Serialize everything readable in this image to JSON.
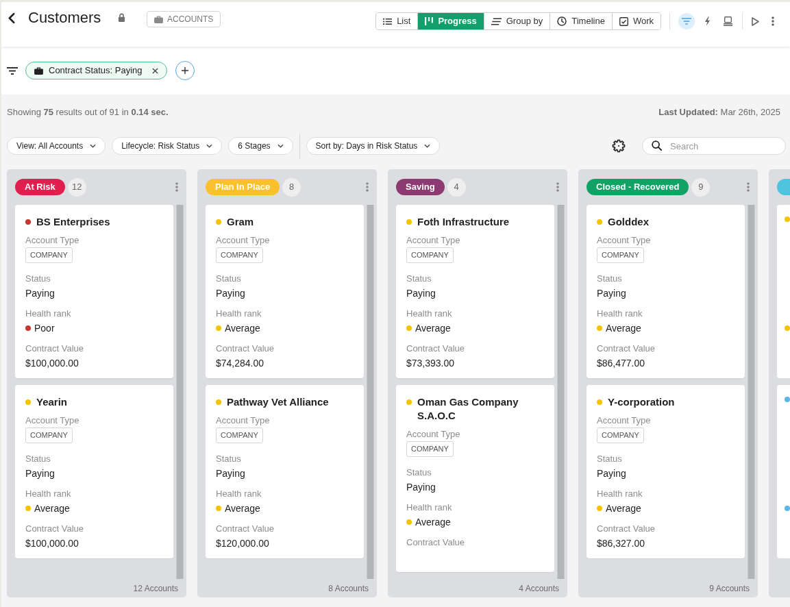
{
  "header": {
    "title": "Customers",
    "locked": true,
    "object_button": "ACCOUNTS"
  },
  "view_tabs": [
    {
      "label": "List",
      "kind": "list",
      "selected": false
    },
    {
      "label": "Progress",
      "kind": "progress",
      "selected": true
    },
    {
      "label": "Group by",
      "kind": "group",
      "selected": false
    },
    {
      "label": "Timeline",
      "kind": "timeline",
      "selected": false
    },
    {
      "label": "Work",
      "kind": "work",
      "selected": false
    }
  ],
  "toolbar_groups": [
    [
      {
        "kind": "filter",
        "active": true
      },
      {
        "kind": "bolt",
        "active": false
      },
      {
        "kind": "monitor",
        "active": false
      }
    ],
    [
      {
        "kind": "play",
        "active": false
      },
      {
        "kind": "more",
        "active": false
      }
    ]
  ],
  "filter_bar": {
    "chips": [
      {
        "label": "Contract Status: Paying"
      }
    ]
  },
  "summary": {
    "results": "Showing **75** results out of 91 in **0.14 sec.**",
    "updated": "**Last Updated:** Mar 26th, 2025"
  },
  "view_dropdowns": [
    {
      "label": "View: All Accounts"
    },
    {
      "label": "Lifecycle: Risk Status"
    },
    {
      "label": "6 Stages"
    }
  ],
  "sort_dropdown": {
    "label": "Sort by: Days in Risk Status"
  },
  "search": {
    "placeholder": "Search"
  },
  "columns": [
    {
      "title": "At Risk",
      "color": "#e01f4f",
      "count": "12",
      "footer": "12 Accounts",
      "cards": [
        {
          "name": "BS Enterprises",
          "color": "#c8372d",
          "fields": [
            {
              "kind": "tag",
              "label": "Account Type",
              "value": "COMPANY"
            },
            {
              "kind": "text",
              "label": "Status",
              "value": "Paying"
            },
            {
              "kind": "rank",
              "label": "Health rank",
              "value": "Poor"
            },
            {
              "kind": "text",
              "label": "Contract Value",
              "value": "$100,000.00"
            }
          ]
        },
        {
          "name": "Yearin",
          "color": "#f5c400",
          "fields": [
            {
              "kind": "tag",
              "label": "Account Type",
              "value": "COMPANY"
            },
            {
              "kind": "text",
              "label": "Status",
              "value": "Paying"
            },
            {
              "kind": "rank",
              "label": "Health rank",
              "value": "Average"
            },
            {
              "kind": "text",
              "label": "Contract Value",
              "value": "$100,000.00"
            }
          ]
        }
      ]
    },
    {
      "title": "Plan In Place",
      "color": "#fbc12d",
      "count": "8",
      "footer": "8 Accounts",
      "cards": [
        {
          "name": "Gram",
          "color": "#f5c400",
          "fields": [
            {
              "kind": "tag",
              "label": "Account Type",
              "value": "COMPANY"
            },
            {
              "kind": "text",
              "label": "Status",
              "value": "Paying"
            },
            {
              "kind": "rank",
              "label": "Health rank",
              "value": "Average"
            },
            {
              "kind": "text",
              "label": "Contract Value",
              "value": "$74,284.00"
            }
          ]
        },
        {
          "name": "Pathway Vet Alliance",
          "color": "#f5c400",
          "fields": [
            {
              "kind": "tag",
              "label": "Account Type",
              "value": "COMPANY"
            },
            {
              "kind": "text",
              "label": "Status",
              "value": "Paying"
            },
            {
              "kind": "rank",
              "label": "Health rank",
              "value": "Average"
            },
            {
              "kind": "text",
              "label": "Contract Value",
              "value": "$120,000.00"
            }
          ]
        }
      ]
    },
    {
      "title": "Saving",
      "color": "#8e3a72",
      "count": "4",
      "footer": "4 Accounts",
      "cards": [
        {
          "name": "Foth Infrastructure",
          "color": "#f5c400",
          "fields": [
            {
              "kind": "tag",
              "label": "Account Type",
              "value": "COMPANY"
            },
            {
              "kind": "text",
              "label": "Status",
              "value": "Paying"
            },
            {
              "kind": "rank",
              "label": "Health rank",
              "value": "Average"
            },
            {
              "kind": "text",
              "label": "Contract Value",
              "value": "$73,393.00"
            }
          ]
        },
        {
          "name": "Oman Gas Company S.A.O.C",
          "color": "#f5c400",
          "fields": [
            {
              "kind": "tag",
              "label": "Account Type",
              "value": "COMPANY"
            },
            {
              "kind": "text",
              "label": "Status",
              "value": "Paying"
            },
            {
              "kind": "rank",
              "label": "Health rank",
              "value": "Average"
            },
            {
              "kind": "text",
              "label": "Contract Value"
            }
          ]
        }
      ]
    },
    {
      "title": "Closed - Recovered",
      "color": "#11a265",
      "count": "9",
      "footer": "9 Accounts",
      "cards": [
        {
          "name": "Golddex",
          "color": "#f5c400",
          "fields": [
            {
              "kind": "tag",
              "label": "Account Type",
              "value": "COMPANY"
            },
            {
              "kind": "text",
              "label": "Status",
              "value": "Paying"
            },
            {
              "kind": "rank",
              "label": "Health rank",
              "value": "Average"
            },
            {
              "kind": "text",
              "label": "Contract Value",
              "value": "$86,477.00"
            }
          ]
        },
        {
          "name": "Y-corporation",
          "color": "#f5c400",
          "fields": [
            {
              "kind": "tag",
              "label": "Account Type",
              "value": "COMPANY"
            },
            {
              "kind": "text",
              "label": "Status",
              "value": "Paying"
            },
            {
              "kind": "rank",
              "label": "Health rank",
              "value": "Average"
            },
            {
              "kind": "text",
              "label": "Contract Value",
              "value": "$86,327.00"
            }
          ]
        }
      ]
    }
  ],
  "partial_column": {
    "color": "#4ec3df",
    "cards": [
      {
        "color": "#f5c400"
      },
      {
        "color": "#5ab8e6"
      }
    ]
  }
}
